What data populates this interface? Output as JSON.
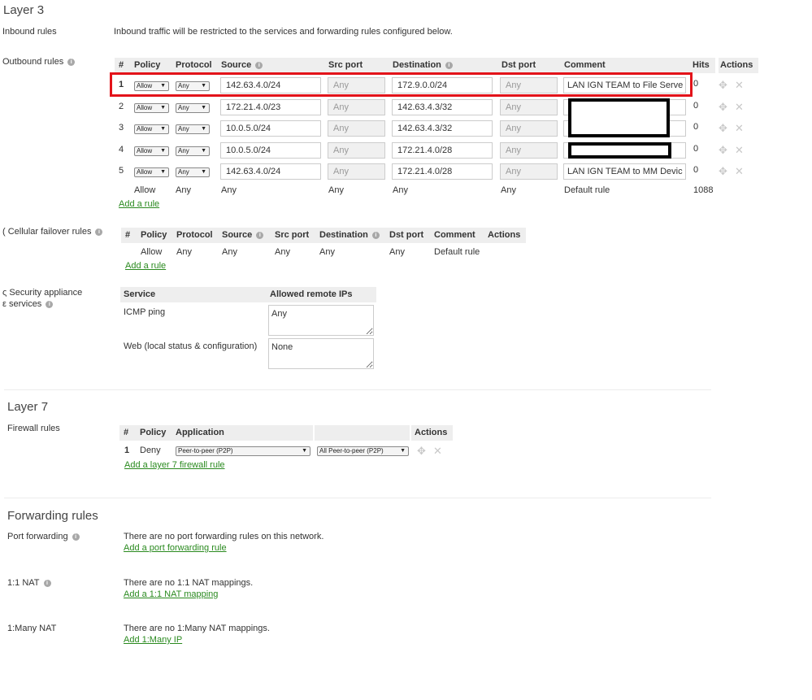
{
  "layer3": {
    "title": "Layer 3",
    "inbound": {
      "label": "Inbound rules",
      "text": "Inbound traffic will be restricted to the services and forwarding rules configured below."
    },
    "outbound": {
      "label": "Outbound rules",
      "headers": [
        "#",
        "Policy",
        "Protocol",
        "Source",
        "Src port",
        "Destination",
        "Dst port",
        "Comment",
        "Hits",
        "Actions"
      ],
      "rules": [
        {
          "num": "1",
          "policy": "Allow",
          "protocol": "Any",
          "source": "142.63.4.0/24",
          "src_port": "Any",
          "destination": "172.9.0.0/24",
          "dst_port": "Any",
          "comment": "LAN IGN TEAM to File Serve",
          "hits": "0"
        },
        {
          "num": "2",
          "policy": "Allow",
          "protocol": "Any",
          "source": "172.21.4.0/23",
          "src_port": "Any",
          "destination": "142.63.4.3/32",
          "dst_port": "Any",
          "comment": "",
          "hits": "0"
        },
        {
          "num": "3",
          "policy": "Allow",
          "protocol": "Any",
          "source": "10.0.5.0/24",
          "src_port": "Any",
          "destination": "142.63.4.3/32",
          "dst_port": "Any",
          "comment": "",
          "hits": "0"
        },
        {
          "num": "4",
          "policy": "Allow",
          "protocol": "Any",
          "source": "10.0.5.0/24",
          "src_port": "Any",
          "destination": "172.21.4.0/28",
          "dst_port": "Any",
          "comment": "",
          "hits": "0"
        },
        {
          "num": "5",
          "policy": "Allow",
          "protocol": "Any",
          "source": "142.63.4.0/24",
          "src_port": "Any",
          "destination": "172.21.4.0/28",
          "dst_port": "Any",
          "comment": "LAN IGN TEAM  to MM Devic",
          "hits": "0"
        }
      ],
      "default_rule": {
        "policy": "Allow",
        "protocol": "Any",
        "source": "Any",
        "src_port": "Any",
        "destination": "Any",
        "dst_port": "Any",
        "comment": "Default rule",
        "hits": "1088"
      },
      "add_rule": "Add a rule"
    },
    "cellular": {
      "label": "Cellular failover rules",
      "headers": [
        "#",
        "Policy",
        "Protocol",
        "Source",
        "Src port",
        "Destination",
        "Dst port",
        "Comment",
        "Actions"
      ],
      "default_rule": {
        "policy": "Allow",
        "protocol": "Any",
        "source": "Any",
        "src_port": "Any",
        "destination": "Any",
        "dst_port": "Any",
        "comment": "Default rule"
      },
      "add_rule": "Add a rule"
    },
    "services": {
      "label_line1": "Security appliance",
      "label_line2": "services",
      "headers": [
        "Service",
        "Allowed remote IPs"
      ],
      "rows": [
        {
          "service": "ICMP ping",
          "allowed": "Any"
        },
        {
          "service": "Web (local status & configuration)",
          "allowed": "None"
        }
      ]
    }
  },
  "layer7": {
    "title": "Layer 7",
    "firewall": {
      "label": "Firewall rules",
      "headers": [
        "#",
        "Policy",
        "Application",
        "",
        "Actions"
      ],
      "rules": [
        {
          "num": "1",
          "policy": "Deny",
          "application": "Peer-to-peer (P2P)",
          "sub_application": "All Peer-to-peer (P2P)"
        }
      ],
      "add_rule": "Add a layer 7 firewall rule"
    }
  },
  "forwarding": {
    "title": "Forwarding rules",
    "port_forwarding": {
      "label": "Port forwarding",
      "text": "There are no port forwarding rules on this network.",
      "link": "Add a port forwarding rule"
    },
    "nat_1to1": {
      "label": "1:1 NAT",
      "text": "There are no 1:1 NAT mappings.",
      "link": "Add a 1:1 NAT mapping"
    },
    "nat_1tomany": {
      "label": "1:Many NAT",
      "text": "There are no 1:Many NAT mappings.",
      "link": "Add 1:Many IP"
    }
  },
  "icons": {
    "info": "i",
    "move": "✥",
    "delete": "✕",
    "dropdown": "▼"
  },
  "colors": {
    "link": "#2a8a1f",
    "highlight": "#e3131a",
    "header_bg": "#eeeeee"
  }
}
